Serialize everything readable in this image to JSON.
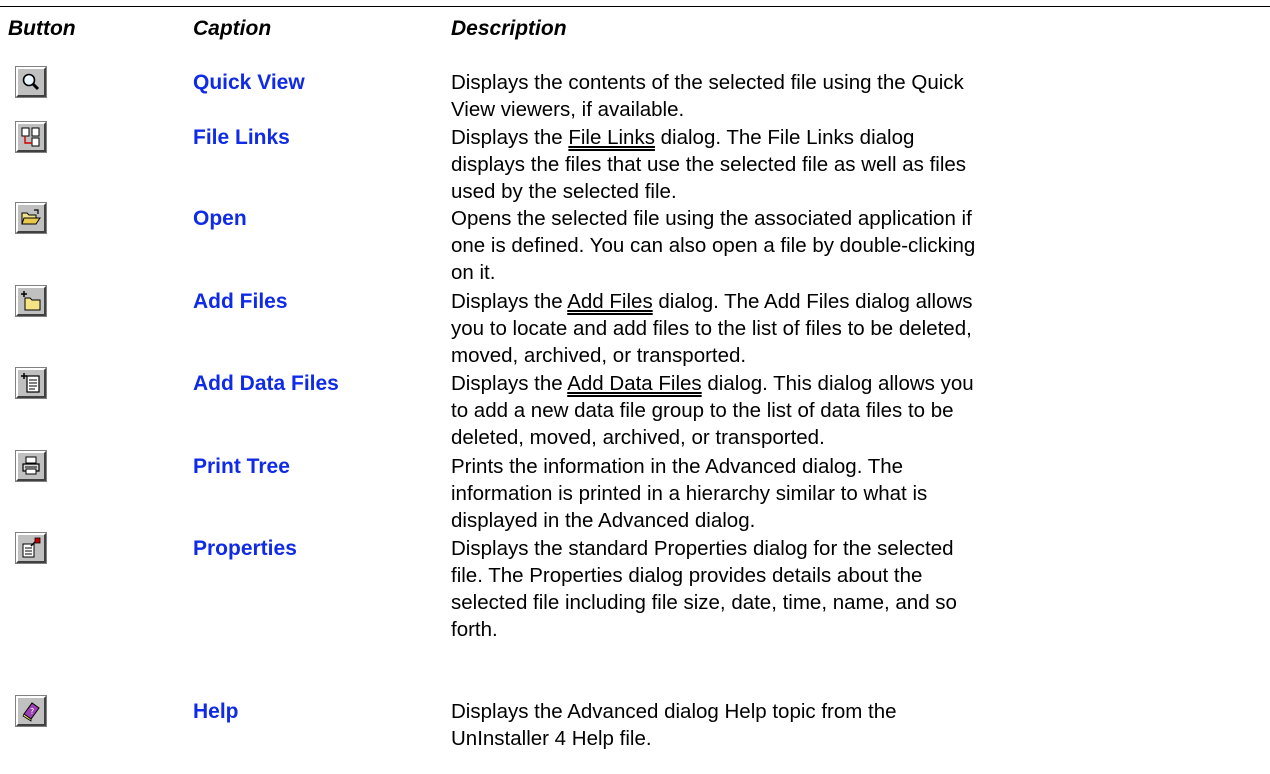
{
  "header": {
    "col_button": "Button",
    "col_caption": "Caption",
    "col_description": "Description"
  },
  "rows": [
    {
      "icon": "magnifier-icon",
      "caption": "Quick View",
      "lines": [
        "Displays the contents of the selected file using the Quick",
        "View viewers, if available."
      ]
    },
    {
      "icon": "file-links-icon",
      "caption": "File Links",
      "desc_before": "Displays the ",
      "link": "File Links",
      "desc_after": " dialog. The File Links dialog",
      "lines": [
        "displays the files that use the selected file as well as files",
        "used by the selected file."
      ]
    },
    {
      "icon": "open-folder-icon",
      "caption": "Open",
      "lines": [
        "Opens the selected file using the associated application if",
        "one is defined. You can also open a file by double-clicking",
        "on it."
      ]
    },
    {
      "icon": "add-folder-icon",
      "caption": "Add Files",
      "desc_before": "Displays the ",
      "link": "Add Files",
      "desc_after": " dialog. The Add Files dialog allows",
      "lines": [
        "you to locate and add files to the list of files to be deleted,",
        "moved, archived, or transported."
      ]
    },
    {
      "icon": "add-document-icon",
      "caption": "Add Data Files",
      "desc_before": "Displays the ",
      "link": "Add Data Files",
      "desc_after": " dialog. This dialog allows you",
      "lines": [
        "to add a new data file group to the list of data files to be",
        "deleted, moved, archived, or transported."
      ]
    },
    {
      "icon": "printer-icon",
      "caption": "Print Tree",
      "lines": [
        "Prints the information in the Advanced dialog. The",
        "information is printed in a hierarchy similar to what is",
        "displayed in the Advanced dialog."
      ]
    },
    {
      "icon": "properties-icon",
      "caption": "Properties",
      "lines": [
        "Displays the standard Properties dialog for the selected",
        "file. The Properties dialog provides details about the",
        "selected file including file size, date, time, name, and so",
        "forth."
      ]
    },
    {
      "icon": "help-book-icon",
      "caption": "Help",
      "lines": [
        "Displays the Advanced dialog Help topic from the",
        "UnInstaller 4 Help file."
      ]
    }
  ]
}
